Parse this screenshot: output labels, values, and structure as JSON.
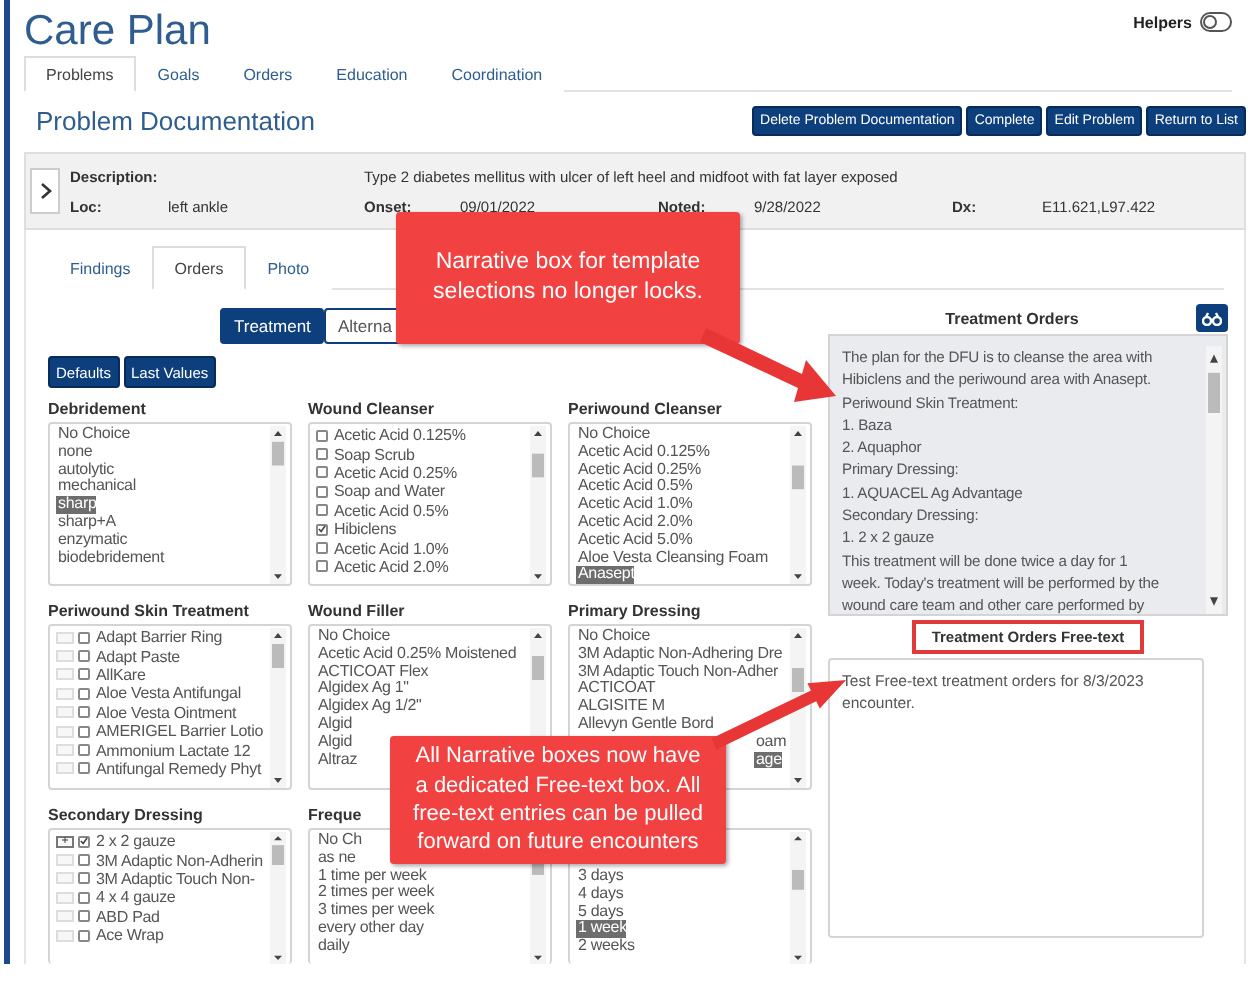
{
  "header": {
    "title": "Care Plan",
    "helpers": {
      "label": "Helpers",
      "on": false
    }
  },
  "tabs": [
    {
      "label": "Problems",
      "selected": true
    },
    {
      "label": "Goals",
      "selected": false
    },
    {
      "label": "Orders",
      "selected": false
    },
    {
      "label": "Education",
      "selected": false
    },
    {
      "label": "Coordination",
      "selected": false
    }
  ],
  "section": {
    "title": "Problem Documentation",
    "buttons": [
      "Delete Problem Documentation",
      "Complete",
      "Edit Problem",
      "Return to List"
    ]
  },
  "problem": {
    "description_label": "Description:",
    "description": "Type 2 diabetes mellitus with ulcer of left heel and midfoot with fat layer exposed",
    "fields": [
      {
        "label": "Loc:",
        "value": "left ankle"
      },
      {
        "label": "Onset:",
        "value": "09/01/2022"
      },
      {
        "label": "Noted:",
        "value": "9/28/2022"
      },
      {
        "label": "Dx:",
        "value": "E11.621,L97.422"
      }
    ]
  },
  "subtabs": [
    {
      "label": "Findings",
      "selected": false
    },
    {
      "label": "Orders",
      "selected": true
    },
    {
      "label": "Photo",
      "selected": false
    }
  ],
  "mode_buttons": [
    {
      "label": "Treatment",
      "selected": true
    },
    {
      "label": "Alterna",
      "selected": false
    }
  ],
  "preset_buttons": [
    "Defaults",
    "Last Values"
  ],
  "lists": [
    {
      "title": "Debridement",
      "kind": "plain",
      "items": [
        {
          "text": "No Choice",
          "selected": false
        },
        {
          "text": "none",
          "selected": false
        },
        {
          "text": "autolytic",
          "selected": false
        },
        {
          "text": "mechanical",
          "selected": false
        },
        {
          "text": "sharp",
          "selected": true
        },
        {
          "text": "sharp+A",
          "selected": false
        },
        {
          "text": "enzymatic",
          "selected": false
        },
        {
          "text": "biodebridement",
          "selected": false
        }
      ]
    },
    {
      "title": "Wound Cleanser",
      "kind": "checkbox",
      "items": [
        {
          "text": "Acetic Acid 0.125%",
          "checked": false
        },
        {
          "text": "Soap Scrub",
          "checked": false
        },
        {
          "text": "Acetic Acid 0.25%",
          "checked": false
        },
        {
          "text": "Soap and Water",
          "checked": false
        },
        {
          "text": "Acetic Acid 0.5%",
          "checked": false
        },
        {
          "text": "Hibiclens",
          "checked": true
        },
        {
          "text": "Acetic Acid 1.0%",
          "checked": false
        },
        {
          "text": "Acetic Acid 2.0%",
          "checked": false
        }
      ]
    },
    {
      "title": "Periwound Cleanser",
      "kind": "plain",
      "items": [
        {
          "text": "No Choice",
          "selected": false
        },
        {
          "text": "Acetic Acid 0.125%",
          "selected": false
        },
        {
          "text": "Acetic Acid 0.25%",
          "selected": false
        },
        {
          "text": "Acetic Acid 0.5%",
          "selected": false
        },
        {
          "text": "Acetic Acid 1.0%",
          "selected": false
        },
        {
          "text": "Acetic Acid 2.0%",
          "selected": false
        },
        {
          "text": "Acetic Acid 5.0%",
          "selected": false
        },
        {
          "text": "Aloe Vesta Cleansing Foam",
          "selected": false
        },
        {
          "text": "Anasept",
          "selected": true
        }
      ]
    },
    {
      "title": "Periwound Skin Treatment",
      "kind": "tree",
      "items": [
        {
          "text": "Adapt Barrier Ring",
          "checked": false
        },
        {
          "text": "Adapt Paste",
          "checked": false
        },
        {
          "text": "AllKare",
          "checked": false
        },
        {
          "text": "Aloe Vesta Antifungal",
          "checked": false
        },
        {
          "text": "Aloe Vesta Ointment",
          "checked": false
        },
        {
          "text": "AMERIGEL Barrier Lotio",
          "checked": false
        },
        {
          "text": "Ammonium Lactate 12",
          "checked": false
        },
        {
          "text": "Antifungal Remedy Phyt",
          "checked": false
        }
      ]
    },
    {
      "title": "Wound Filler",
      "kind": "plain",
      "items": [
        {
          "text": "No Choice",
          "selected": false
        },
        {
          "text": "Acetic Acid 0.25% Moistened",
          "selected": false
        },
        {
          "text": "ACTICOAT Flex",
          "selected": false
        },
        {
          "text": "Algidex Ag 1\"",
          "selected": false
        },
        {
          "text": "Algidex Ag 1/2\"",
          "selected": false
        },
        {
          "text": "Algid",
          "selected": false
        },
        {
          "text": "Algid",
          "selected": false
        },
        {
          "text": "Altraz",
          "selected": false
        }
      ]
    },
    {
      "title": "Primary Dressing",
      "kind": "plain",
      "items": [
        {
          "text": "No Choice",
          "selected": false
        },
        {
          "text": "3M Adaptic Non-Adhering Dre",
          "selected": false
        },
        {
          "text": "3M Adaptic Touch Non-Adher",
          "selected": false
        },
        {
          "text": "ACTICOAT",
          "selected": false
        },
        {
          "text": "ALGISITE M",
          "selected": false
        },
        {
          "text": "Allevyn Gentle Bord",
          "selected": false
        },
        {
          "text": "oam",
          "selected": false,
          "covered": true
        },
        {
          "text": "age",
          "selected": true,
          "covered": true
        }
      ]
    },
    {
      "title": "Secondary Dressing",
      "kind": "tree",
      "items": [
        {
          "text": "2 x 2 gauze",
          "checked": true,
          "marker": "+"
        },
        {
          "text": "3M Adaptic Non-Adherin",
          "checked": false
        },
        {
          "text": "3M Adaptic Touch Non-",
          "checked": false
        },
        {
          "text": "4 x 4 gauze",
          "checked": false
        },
        {
          "text": "ABD Pad",
          "checked": false
        },
        {
          "text": "Ace Wrap",
          "checked": false
        }
      ]
    },
    {
      "title": "Freque",
      "kind": "plain",
      "items": [
        {
          "text": "No Ch",
          "selected": false
        },
        {
          "text": "as ne",
          "selected": false
        },
        {
          "text": "1 time per week",
          "selected": false
        },
        {
          "text": "2 times per week",
          "selected": false
        },
        {
          "text": "3 times per week",
          "selected": false
        },
        {
          "text": "every other day",
          "selected": false
        },
        {
          "text": "daily",
          "selected": false
        }
      ]
    },
    {
      "kind": "plain",
      "items": [
        {
          "text": "3 days",
          "selected": false
        },
        {
          "text": "4 days",
          "selected": false
        },
        {
          "text": "5 days",
          "selected": false
        },
        {
          "text": "1 week",
          "selected": true
        },
        {
          "text": "2 weeks",
          "selected": false
        }
      ]
    }
  ],
  "treatment_orders": {
    "title": "Treatment Orders",
    "narrative": [
      "The plan for the DFU is to cleanse the area with",
      "Hibiclens and the periwound area with Anasept.",
      "Periwound Skin Treatment:",
      "1. Baza",
      "2. Aquaphor",
      "Primary Dressing:",
      "1. AQUACEL Ag Advantage",
      "Secondary Dressing:",
      "1. 2 x 2 gauze",
      "This treatment will be done twice a day for 1",
      "week. Today's treatment will be performed by the",
      "wound care team and other care performed by"
    ],
    "freetext_label": "Treatment Orders Free-text",
    "freetext": "Test Free-text treatment orders for 8/3/2023 encounter."
  },
  "callouts": [
    "Narrative box for template selections no longer locks.",
    "All Narrative boxes now have a dedicated Free-text box. All free-text entries can be pulled forward on future encounters"
  ]
}
